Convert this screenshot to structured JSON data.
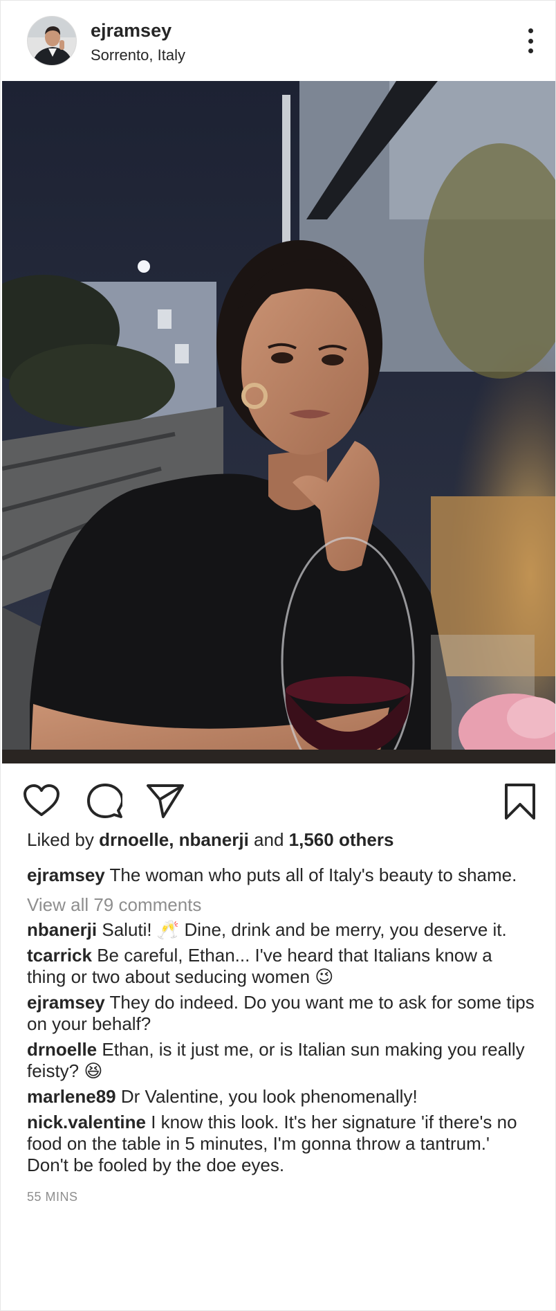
{
  "post": {
    "username": "ejramsey",
    "location": "Sorrento, Italy",
    "likes": {
      "prefix": "Liked by",
      "users": "drnoelle, nbanerji",
      "connector": "and",
      "others": "1,560 others"
    },
    "caption": {
      "username": "ejramsey",
      "text": "The woman who puts all of Italy's beauty to shame."
    },
    "view_all_comments": "View all 79 comments",
    "comments": [
      {
        "username": "nbanerji",
        "text": "Saluti! 🥂 Dine, drink and be merry, you deserve it."
      },
      {
        "username": "tcarrick",
        "text": "Be careful, Ethan... I've heard that Italians know a thing or two about seducing women 😉"
      },
      {
        "username": "ejramsey",
        "text": "They do indeed. Do you want me to ask for some tips on your behalf?"
      },
      {
        "username": "drnoelle",
        "text": "Ethan, is it just me, or is Italian sun making you really feisty? 😆"
      },
      {
        "username": "marlene89",
        "text": "Dr Valentine, you look phenomenally!"
      },
      {
        "username": "nick.valentine",
        "text": "I know this look. It's her signature 'if there's no food on the table in 5 minutes, I'm gonna throw a tantrum.' Don't be fooled by the doe eyes."
      }
    ],
    "timestamp": "55 MINS"
  },
  "icons": {
    "more": "more-options-icon",
    "like": "heart-icon",
    "comment": "comment-bubble-icon",
    "share": "paper-plane-icon",
    "save": "bookmark-icon"
  },
  "colors": {
    "text": "#262626",
    "muted": "#8e8e8e"
  }
}
